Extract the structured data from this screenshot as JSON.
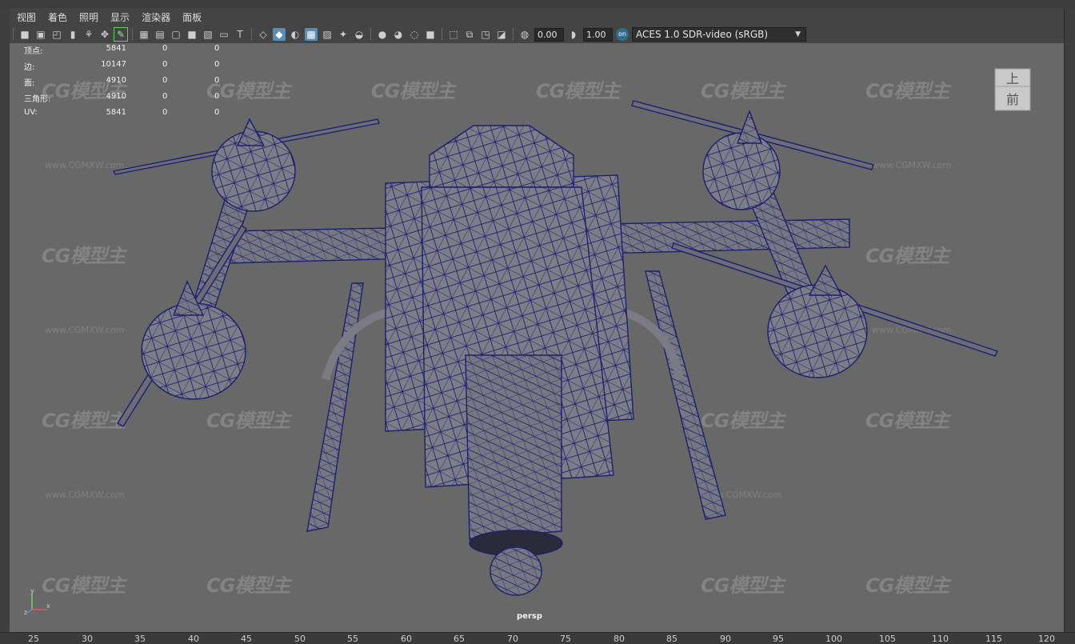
{
  "menubar": {
    "items": [
      "视图",
      "着色",
      "照明",
      "显示",
      "渲染器",
      "面板"
    ]
  },
  "toolbar": {
    "icons": [
      "camera-icon",
      "camera-attr-icon",
      "bookmark-icon",
      "image-plane-icon",
      "grease-pencil-icon",
      "2d-pan-icon",
      "grid-icon",
      "film-gate-icon",
      "resolution-gate-icon",
      "gate-mask-icon",
      "field-chart-icon",
      "safe-action-icon",
      "safe-title-icon",
      "wireframe-icon",
      "smooth-shade-icon",
      "flat-shade-icon",
      "wireframe-on-shaded-icon",
      "xray-icon",
      "use-lights-icon",
      "shadows-icon",
      "ambient-occlusion-icon",
      "motion-blur-icon",
      "anti-alias-icon",
      "depth-of-field-icon",
      "isolate-select-icon",
      "xray-joints-icon",
      "xray-active-icon",
      "backface-icon",
      "textures-icon",
      "exposure-icon",
      "gamma-icon",
      "color-management-icon"
    ],
    "exposure": "0.00",
    "gamma": "1.00",
    "color_space": "ACES 1.0 SDR-video (sRGB)"
  },
  "stats": [
    {
      "label": "顶点:",
      "v1": "5841",
      "v2": "0",
      "v3": "0"
    },
    {
      "label": "边:",
      "v1": "10147",
      "v2": "0",
      "v3": "0"
    },
    {
      "label": "面:",
      "v1": "4910",
      "v2": "0",
      "v3": "0"
    },
    {
      "label": "三角形:",
      "v1": "4910",
      "v2": "0",
      "v3": "0"
    },
    {
      "label": "UV:",
      "v1": "5841",
      "v2": "0",
      "v3": "0"
    }
  ],
  "viewcube": {
    "top": "上",
    "front": "前"
  },
  "camera_label": "persp",
  "axis": {
    "x": "x",
    "y": "y",
    "z": "z"
  },
  "watermark": {
    "logo": "CG模型主",
    "url": "www.CGMXW.com"
  },
  "ruler": [
    "25",
    "30",
    "35",
    "40",
    "45",
    "50",
    "55",
    "60",
    "65",
    "70",
    "75",
    "80",
    "85",
    "90",
    "95",
    "100",
    "105",
    "110",
    "115",
    "120"
  ],
  "colors": {
    "viewport_bg": "#686868",
    "model_fill": "#7a7a84",
    "wireframe": "#1e1f6e",
    "accent": "#5a8db3"
  }
}
